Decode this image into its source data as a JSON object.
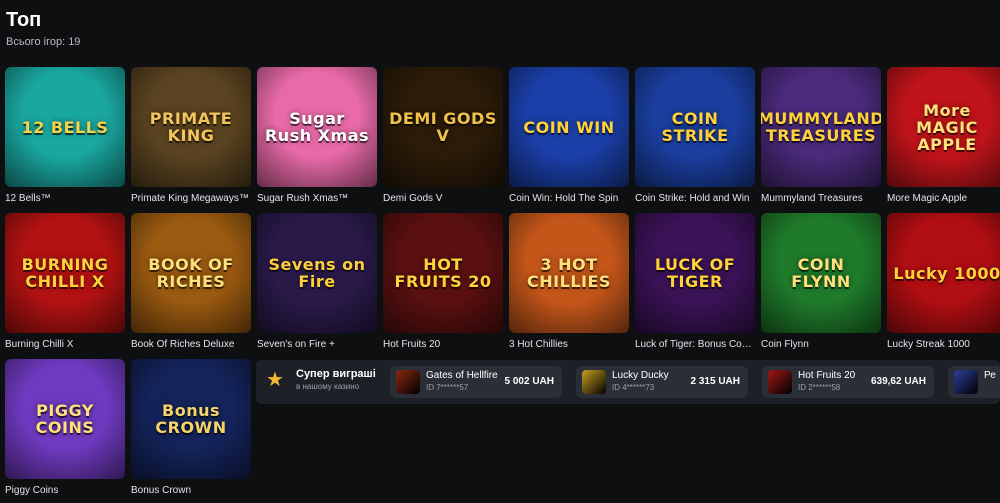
{
  "header": {
    "title": "Топ",
    "subtitle": "Всього ігор: 19"
  },
  "games_row1": [
    {
      "title": "12 Bells™",
      "art": "12 BELLS",
      "bg": "#1aa7a0",
      "fg": "#f7d24a"
    },
    {
      "title": "Primate King Megaways™",
      "art": "PRIMATE KING",
      "bg": "#5a4320",
      "fg": "#f2c65a"
    },
    {
      "title": "Sugar Rush Xmas™",
      "art": "Sugar Rush Xmas",
      "bg": "#e86aa8",
      "fg": "#ffffff"
    },
    {
      "title": "Demi Gods V",
      "art": "DEMI GODS V",
      "bg": "#2b1b08",
      "fg": "#f0c24a"
    },
    {
      "title": "Coin Win: Hold The Spin",
      "art": "COIN WIN",
      "bg": "#1b3fa8",
      "fg": "#ffd23a"
    },
    {
      "title": "Coin Strike: Hold and Win",
      "art": "COIN STRIKE",
      "bg": "#1a3e9e",
      "fg": "#ffd23a"
    },
    {
      "title": "Mummyland Treasures",
      "art": "MUMMYLAND TREASURES",
      "bg": "#4a2a7a",
      "fg": "#ffd23a"
    },
    {
      "title": "More Magic Apple",
      "art": "More MAGIC APPLE",
      "bg": "#c0141a",
      "fg": "#ffe07a"
    }
  ],
  "games_row2": [
    {
      "title": "Burning Chilli X",
      "art": "BURNING CHILLI X",
      "bg": "#b31212",
      "fg": "#ffd23a"
    },
    {
      "title": "Book Of Riches Deluxe",
      "art": "BOOK OF RICHES",
      "bg": "#9a5a10",
      "fg": "#ffe07a"
    },
    {
      "title": "Seven's on Fire +",
      "art": "Sevens on Fire",
      "bg": "#2a1a4a",
      "fg": "#ffcf3a"
    },
    {
      "title": "Hot Fruits 20",
      "art": "HOT FRUITS 20",
      "bg": "#5a1010",
      "fg": "#ffd23a"
    },
    {
      "title": "3 Hot Chillies",
      "art": "3 HOT CHILLIES",
      "bg": "#c4561a",
      "fg": "#ffe07a"
    },
    {
      "title": "Luck of Tiger: Bonus Combo",
      "art": "LUCK OF TIGER",
      "bg": "#3a1256",
      "fg": "#ffd23a"
    },
    {
      "title": "Coin Flynn",
      "art": "COIN FLYNN",
      "bg": "#1f7a2a",
      "fg": "#ffe07a"
    },
    {
      "title": "Lucky Streak 1000",
      "art": "Lucky 1000",
      "bg": "#b00e12",
      "fg": "#ffd23a"
    }
  ],
  "games_row3": [
    {
      "title": "Piggy Coins",
      "art": "PIGGY COINS",
      "bg": "#6f3ac0",
      "fg": "#ffe07a"
    },
    {
      "title": "Bonus Crown",
      "art": "Bonus CROWN",
      "bg": "#14235a",
      "fg": "#f5d46a"
    }
  ],
  "winners": {
    "title": "Супер виграші",
    "subtitle": "в нашому казино",
    "star_icon": "star-icon",
    "items": [
      {
        "game": "Gates of Hellfire",
        "id": "ID 7******57",
        "amount": "5 002 UAH",
        "color": "#8a2a10"
      },
      {
        "game": "Lucky Ducky",
        "id": "ID 4******73",
        "amount": "2 315 UAH",
        "color": "#c8a020"
      },
      {
        "game": "Hot Fruits 20",
        "id": "ID 2******58",
        "amount": "639,62 UAH",
        "color": "#a01818"
      },
      {
        "game": "Ре",
        "id": "",
        "amount": "",
        "color": "#2c3f9a"
      }
    ]
  }
}
